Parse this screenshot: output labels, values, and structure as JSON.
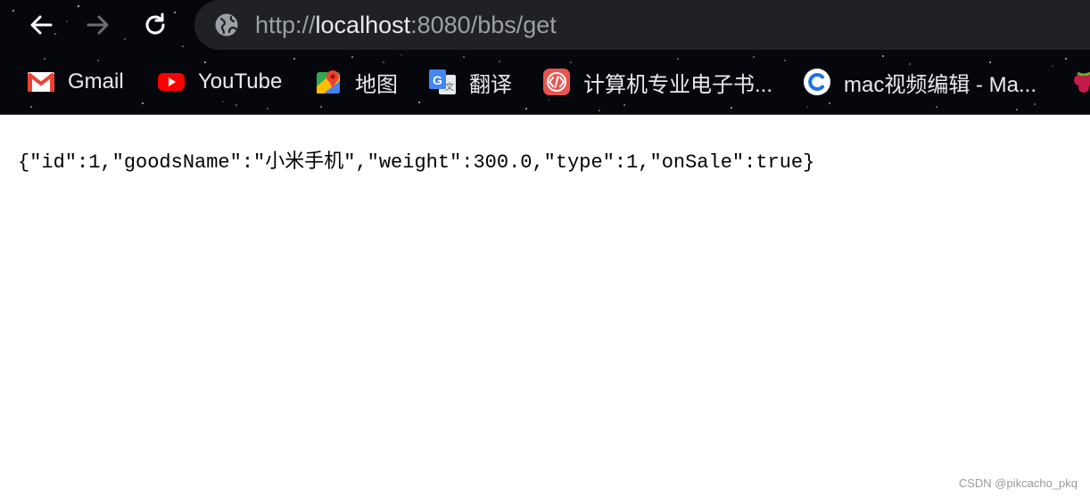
{
  "toolbar": {
    "back_icon": "arrow-left-icon",
    "forward_icon": "arrow-right-icon",
    "reload_icon": "reload-icon",
    "url_scheme": "http://",
    "url_host": "localhost",
    "url_rest": ":8080/bbs/get"
  },
  "bookmarks": [
    {
      "label": "Gmail",
      "icon": "gmail-icon"
    },
    {
      "label": "YouTube",
      "icon": "youtube-icon"
    },
    {
      "label": "地图",
      "icon": "maps-icon"
    },
    {
      "label": "翻译",
      "icon": "translate-icon"
    },
    {
      "label": "计算机专业电子书...",
      "icon": "code-icon"
    },
    {
      "label": "mac视频编辑 - Ma...",
      "icon": "circle-c-icon"
    },
    {
      "label": "",
      "icon": "raspberry-icon"
    }
  ],
  "page": {
    "json_body": "{\"id\":1,\"goodsName\":\"小米手机\",\"weight\":300.0,\"type\":1,\"onSale\":true}",
    "watermark": "CSDN @pikcacho_pkq"
  },
  "colors": {
    "chrome_bg": "#05070d",
    "omnibox_bg": "#202124",
    "url_dim": "#9aa0a6",
    "url_host": "#e8eaed"
  }
}
